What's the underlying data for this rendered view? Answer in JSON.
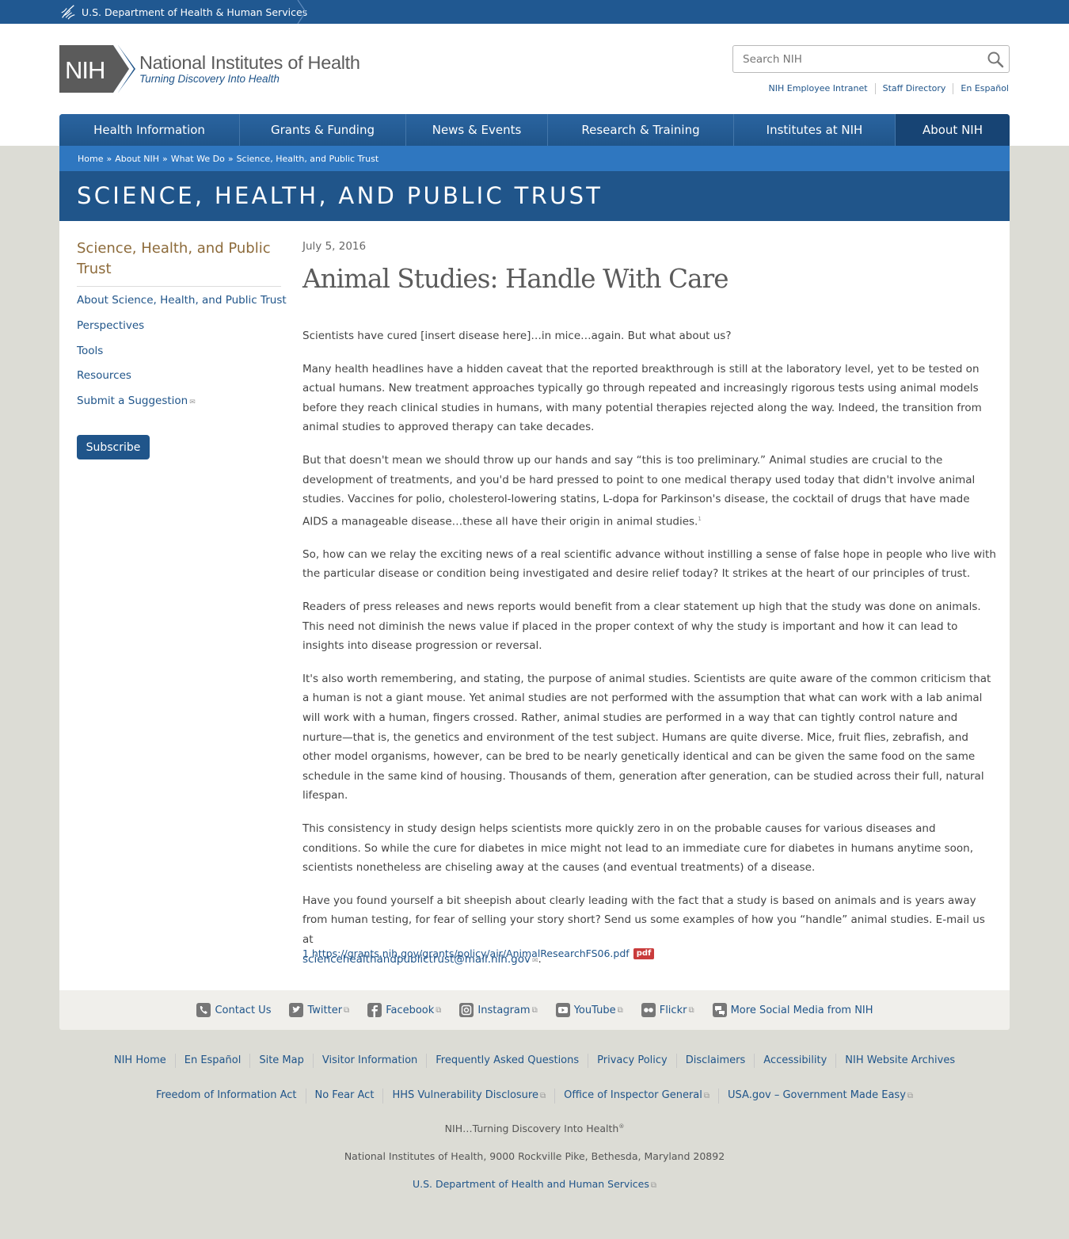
{
  "hhs_bar": {
    "label": "U.S. Department of Health & Human Services"
  },
  "logo": {
    "badge": "NIH",
    "title": "National Institutes of Health",
    "tagline": "Turning Discovery Into Health"
  },
  "search": {
    "placeholder": "Search NIH",
    "icon": "search-icon"
  },
  "utility_links": [
    "NIH Employee Intranet",
    "Staff Directory",
    "En Español"
  ],
  "nav": [
    "Health Information",
    "Grants & Funding",
    "News & Events",
    "Research & Training",
    "Institutes at NIH",
    "About NIH"
  ],
  "breadcrumb": [
    "Home",
    "About NIH",
    "What We Do",
    "Science, Health, and Public Trust"
  ],
  "page_title": "SCIENCE, HEALTH, AND PUBLIC TRUST",
  "sidebar": {
    "title": "Science, Health, and Public Trust",
    "items": [
      "About Science, Health, and Public Trust",
      "Perspectives",
      "Tools",
      "Resources",
      "Submit a Suggestion"
    ],
    "subscribe": "Subscribe"
  },
  "article": {
    "date": "July 5, 2016",
    "title": "Animal Studies: Handle With Care",
    "paragraphs": [
      "Scientists have cured [insert disease here]…in mice…again. But what about us?",
      "Many health headlines have a hidden caveat that the reported breakthrough is still at the laboratory level, yet to be tested on actual humans. New treatment approaches typically go through repeated and increasingly rigorous tests using animal models before they reach clinical studies in humans, with many potential therapies rejected along the way. Indeed, the transition from animal studies to approved therapy can take decades.",
      "But that doesn't mean we should throw up our hands and say “this is too preliminary.” Animal studies are crucial to the development of treatments, and you'd be hard pressed to point to one medical therapy used today that didn't involve animal studies. Vaccines for polio, cholesterol-lowering statins, L-dopa for Parkinson's disease, the cocktail of drugs that have made AIDS a manageable disease…these all have their origin in animal studies.",
      "So, how can we relay the exciting news of a real scientific advance without instilling a sense of false hope in people who live with the particular disease or condition being investigated and desire relief today? It strikes at the heart of our principles of trust.",
      "Readers of press releases and news reports would benefit from a clear statement up high that the study was done on animals. This need not diminish the news value if placed in the proper context of why the study is important and how it can lead to insights into disease progression or reversal.",
      "It's also worth remembering, and stating, the purpose of animal studies. Scientists are quite aware of the common criticism that a human is not a giant mouse. Yet animal studies are not performed with the assumption that what can work with a lab animal will work with a human, fingers crossed. Rather, animal studies are performed in a way that can tightly control nature and nurture—that is, the genetics and environment of the test subject. Humans are quite diverse. Mice, fruit flies, zebrafish, and other model organisms, however, can be bred to be nearly genetically identical and can be given the same food on the same schedule in the same kind of housing. Thousands of them, generation after generation, can be studied across their full, natural lifespan.",
      "This consistency in study design helps scientists more quickly zero in on the probable causes for various diseases and conditions. So while the cure for diabetes in mice might not lead to an immediate cure for diabetes in humans anytime soon, scientists nonetheless are chiseling away at the causes (and eventual treatments) of a disease.",
      "Have you found yourself a bit sheepish about clearly leading with the fact that a study is based on animals and is years away from human testing, for fear of selling your story short? Send us some examples of how you “handle” animal studies. E-mail us at"
    ],
    "footnote_marker": "1",
    "email": "sciencehealthandpublictrust@mail.nih.gov",
    "email_suffix": ".",
    "footnote": "1 https://grants.nih.gov/grants/policy/air/AnimalResearchFS06.pdf",
    "pdf_badge": "pdf"
  },
  "social": [
    "Contact Us",
    "Twitter",
    "Facebook",
    "Instagram",
    "YouTube",
    "Flickr",
    "More Social Media from NIH"
  ],
  "footer": {
    "row1": [
      "NIH Home",
      "En Español",
      "Site Map",
      "Visitor Information",
      "Frequently Asked Questions",
      "Privacy Policy",
      "Disclaimers",
      "Accessibility",
      "NIH Website Archives"
    ],
    "row2": [
      "Freedom of Information Act",
      "No Fear Act",
      "HHS Vulnerability Disclosure",
      "Office of Inspector General",
      "USA.gov – Government Made Easy"
    ],
    "tagline": "NIH…Turning Discovery Into Health",
    "tagline_mark": "®",
    "address": "National Institutes of Health, 9000 Rockville Pike, Bethesda, Maryland 20892",
    "hhs_link": "U.S. Department of Health and Human Services"
  },
  "colors": {
    "primary": "#20558a",
    "breadcrumb": "#2f77c0",
    "sidebar_title": "#8d6b3b",
    "page_bg": "#dcdcd5",
    "pdf": "#c93c3c"
  }
}
